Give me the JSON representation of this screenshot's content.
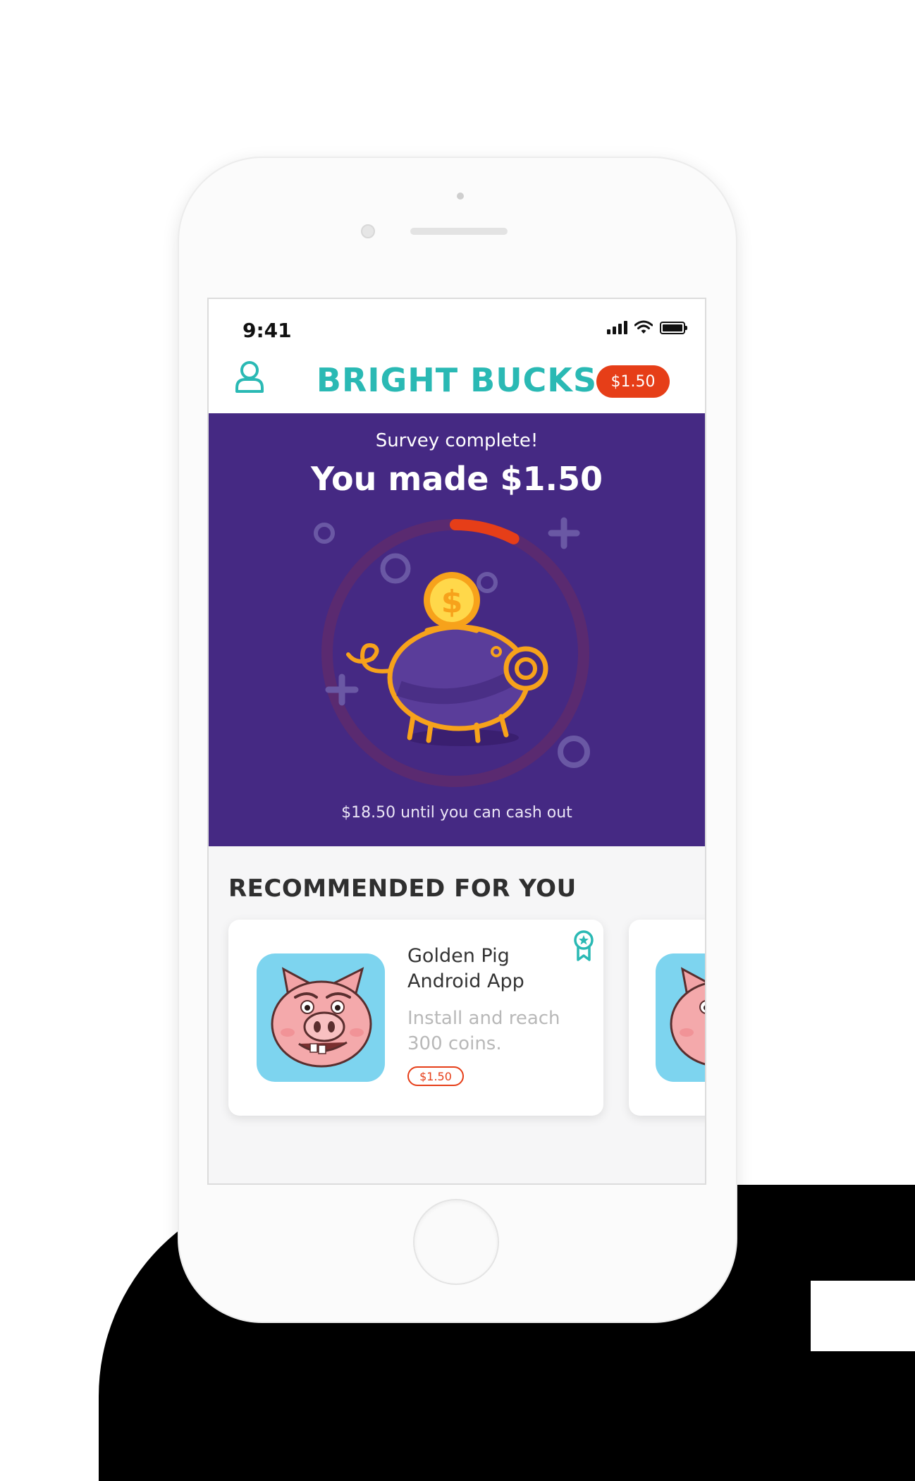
{
  "status_bar": {
    "time": "9:41"
  },
  "header": {
    "brand": "BRIGHT BUCKS",
    "balance": "$1.50",
    "profile_icon": "user-outline-icon"
  },
  "hero": {
    "subtitle": "Survey complete!",
    "title": "You made $1.50",
    "footer": "$18.50 until you can cash out",
    "progress_fraction": 0.075,
    "illustration": "piggy-bank-coin-icon"
  },
  "recommended": {
    "title": "RECOMMENDED FOR YOU",
    "cards": [
      {
        "title": "Golden Pig Android App",
        "description": "Install and reach 300 coins.",
        "reward": "$1.50",
        "icon": "ribbon-star-icon"
      }
    ]
  },
  "colors": {
    "brand_teal": "#2ab9b4",
    "accent_red": "#e63e18",
    "hero_purple": "#452983",
    "coin_orange": "#f7a21b"
  }
}
